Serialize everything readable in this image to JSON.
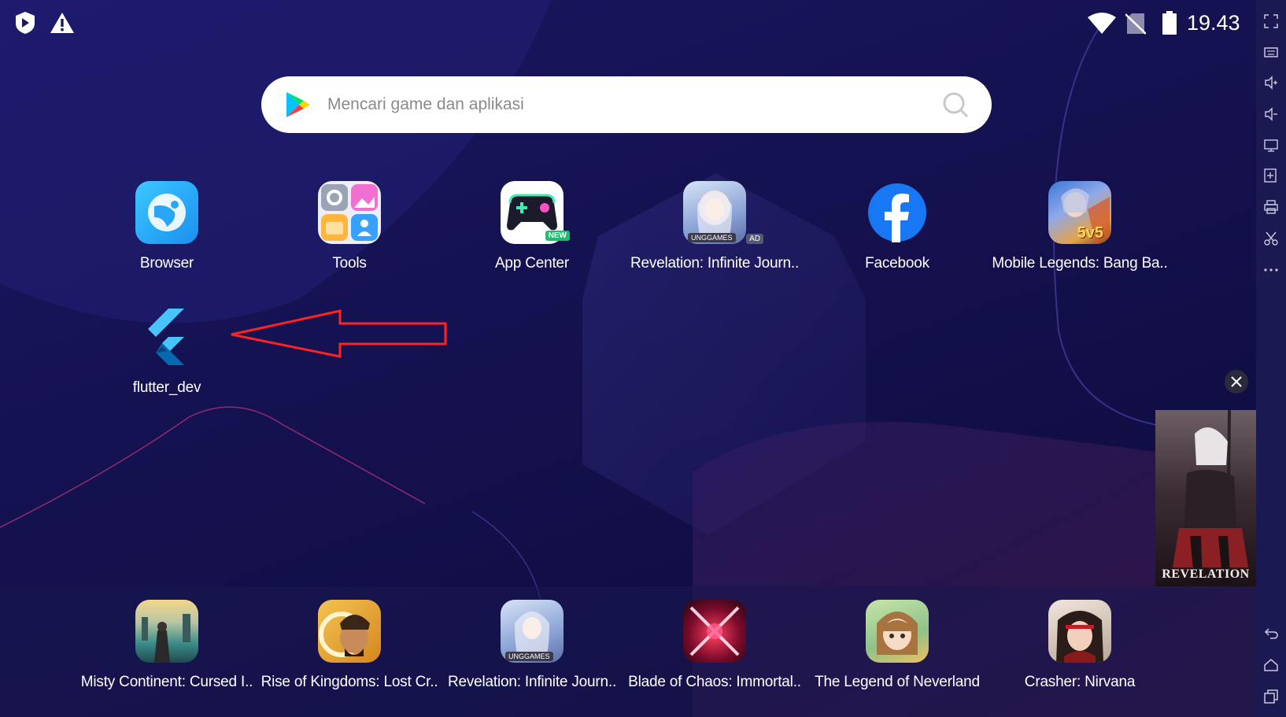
{
  "status_bar": {
    "time": "19.43"
  },
  "search": {
    "placeholder": "Mencari game dan aplikasi"
  },
  "apps": [
    {
      "label": "Browser"
    },
    {
      "label": "Tools"
    },
    {
      "label": "App Center",
      "badge": "NEW"
    },
    {
      "label": "Revelation: Infinite Journ..",
      "badge": "AD",
      "sub_badge": "UNGGAMES"
    },
    {
      "label": "Facebook"
    },
    {
      "label": "Mobile Legends: Bang Ba..",
      "tile_text": "5v5"
    },
    {
      "label": "flutter_dev"
    }
  ],
  "dock_apps": [
    {
      "label": "Misty Continent: Cursed I.."
    },
    {
      "label": "Rise of Kingdoms: Lost Cr.."
    },
    {
      "label": "Revelation: Infinite Journ..",
      "sub_badge": "UNGGAMES"
    },
    {
      "label": "Blade of Chaos: Immortal.."
    },
    {
      "label": "The Legend of Neverland"
    },
    {
      "label": "Crasher: Nirvana"
    }
  ],
  "ad": {
    "title": "REVELATION"
  },
  "sidebar_icons": [
    "fullscreen-icon",
    "keyboard-icon",
    "volume-up-icon",
    "volume-down-icon",
    "screen-icon",
    "apk-install-icon",
    "print-icon",
    "scissors-icon",
    "more-icon",
    "back-icon",
    "home-icon",
    "recents-icon"
  ]
}
